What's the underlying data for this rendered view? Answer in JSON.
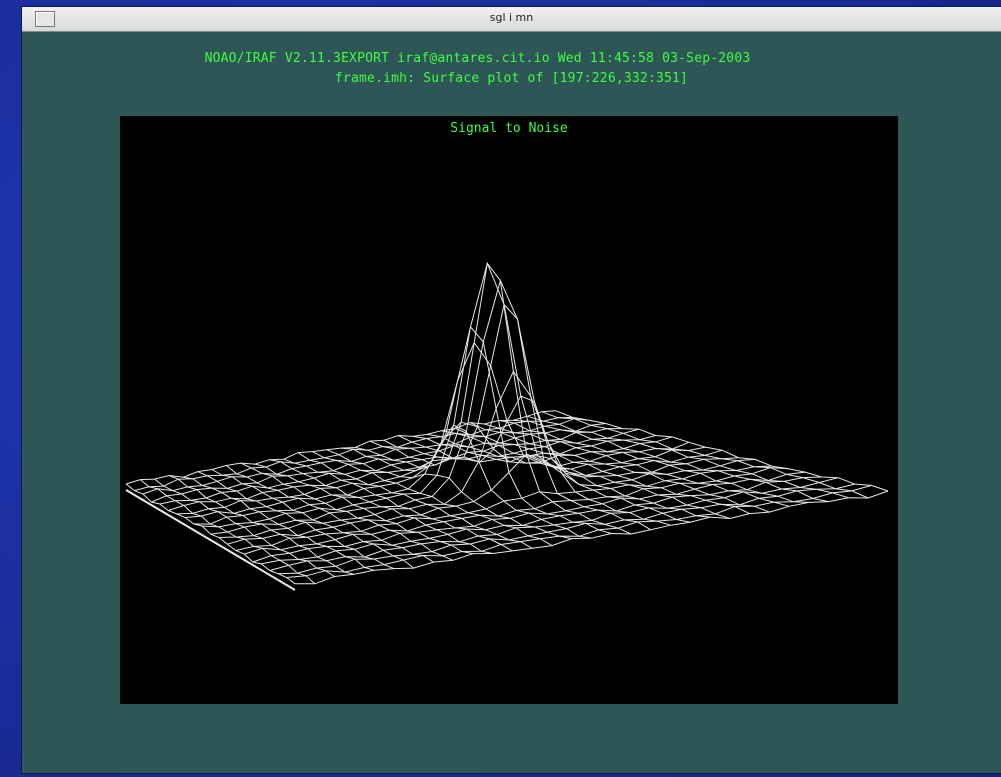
{
  "window": {
    "title": "sgl i mn"
  },
  "header": {
    "line1": "NOAO/IRAF V2.11.3EXPORT iraf@antares.cit.io Wed 11:45:58 03-Sep-2003",
    "line2": "frame.imh: Surface plot of [197:226,332:351]"
  },
  "plot": {
    "title": "Signal to Noise",
    "line_color": "#e8e8e8",
    "text_color": "#3cff3c"
  }
}
